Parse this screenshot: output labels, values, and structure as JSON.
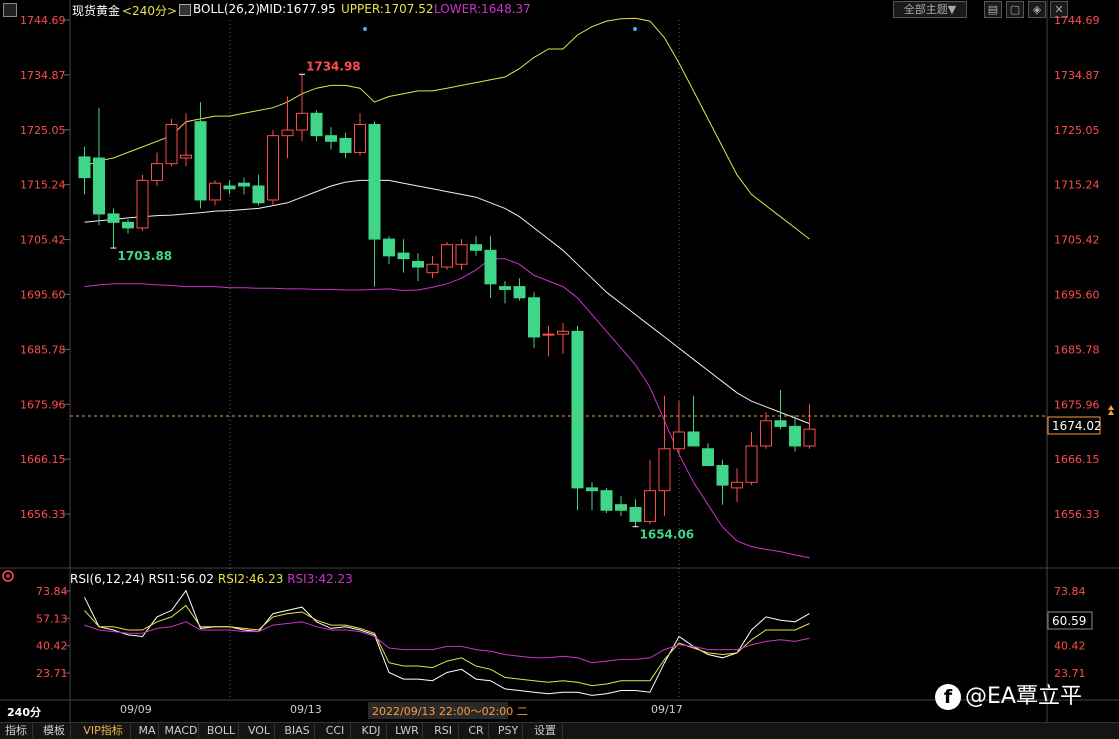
{
  "header": {
    "symbol": "现货黄金",
    "period": "<240分>",
    "indicator": "BOLL(26,2)",
    "mid": "MID:1677.95",
    "upper": "UPPER:1707.52",
    "lower": "LOWER:1648.37",
    "theme_button": "全部主题▼",
    "win_buttons": [
      "▤",
      "▢",
      "◈",
      "✕"
    ]
  },
  "main_chart": {
    "ticks": [
      "1744.69",
      "1734.87",
      "1725.05",
      "1715.24",
      "1705.42",
      "1695.60",
      "1685.78",
      "1675.96",
      "1666.15",
      "1656.33"
    ],
    "current_price": "1674.02",
    "high_label": "1734.98",
    "low_label_1": "1703.88",
    "low_label_2": "1654.06"
  },
  "rsi": {
    "title": "RSI(6,12,24)",
    "rsi1": "RSI1:56.02",
    "rsi2": "RSI2:46.23",
    "rsi3": "RSI3:42.23",
    "ticks": [
      "73.84",
      "57.13",
      "40.42",
      "23.71"
    ],
    "current": "60.59"
  },
  "time_axis": {
    "labels": [
      "09/09",
      "09/13",
      "09/17"
    ],
    "cursor_label": "2022/09/13 22:00～02:00 二"
  },
  "bottom_bar": {
    "period": "240分",
    "tabs": [
      "指标",
      "模板",
      "VIP指标",
      "MA",
      "MACD",
      "BOLL",
      "VOL",
      "BIAS",
      "CCI",
      "KDJ",
      "LWR",
      "RSI",
      "CR",
      "PSY",
      "设置"
    ]
  },
  "watermark": "@EA覃立平",
  "colors": {
    "up": "#ff4d4d",
    "down": "#3fd68a",
    "upper_band": "#e8e34a",
    "mid_band": "#f0f0f0",
    "lower_band": "#cc33cc",
    "axis_text": "#ff4d4d"
  },
  "chart_data": [
    {
      "type": "candlestick",
      "title": "现货黄金 240分",
      "ylim": [
        1652,
        1747
      ],
      "x": [
        "09/09",
        "09/13",
        "09/17"
      ],
      "candles": [
        {
          "o": 1720.2,
          "h": 1722.0,
          "l": 1713.5,
          "c": 1716.5
        },
        {
          "o": 1720.0,
          "h": 1729.0,
          "l": 1708.0,
          "c": 1710.0
        },
        {
          "o": 1710.0,
          "h": 1711.0,
          "l": 1703.9,
          "c": 1708.5
        },
        {
          "o": 1708.5,
          "h": 1709.0,
          "l": 1706.5,
          "c": 1707.5
        },
        {
          "o": 1707.5,
          "h": 1717.0,
          "l": 1707.0,
          "c": 1716.0
        },
        {
          "o": 1716.0,
          "h": 1721.0,
          "l": 1715.0,
          "c": 1719.0
        },
        {
          "o": 1719.0,
          "h": 1727.0,
          "l": 1718.5,
          "c": 1726.0
        },
        {
          "o": 1720.0,
          "h": 1728.0,
          "l": 1718.5,
          "c": 1720.5
        },
        {
          "o": 1726.5,
          "h": 1730.0,
          "l": 1711.0,
          "c": 1712.5
        },
        {
          "o": 1712.5,
          "h": 1716.0,
          "l": 1711.5,
          "c": 1715.5
        },
        {
          "o": 1715.0,
          "h": 1716.0,
          "l": 1713.5,
          "c": 1714.5
        },
        {
          "o": 1715.5,
          "h": 1716.5,
          "l": 1713.5,
          "c": 1715.0
        },
        {
          "o": 1715.0,
          "h": 1717.0,
          "l": 1711.5,
          "c": 1712.0
        },
        {
          "o": 1712.5,
          "h": 1725.0,
          "l": 1711.5,
          "c": 1724.0
        },
        {
          "o": 1724.0,
          "h": 1731.0,
          "l": 1720.0,
          "c": 1725.0
        },
        {
          "o": 1725.0,
          "h": 1734.98,
          "l": 1723.0,
          "c": 1728.0
        },
        {
          "o": 1728.0,
          "h": 1728.5,
          "l": 1723.0,
          "c": 1724.0
        },
        {
          "o": 1724.0,
          "h": 1725.5,
          "l": 1721.5,
          "c": 1723.0
        },
        {
          "o": 1723.5,
          "h": 1724.5,
          "l": 1720.0,
          "c": 1721.0
        },
        {
          "o": 1721.0,
          "h": 1728.0,
          "l": 1720.5,
          "c": 1726.0
        },
        {
          "o": 1726.0,
          "h": 1726.5,
          "l": 1697.0,
          "c": 1705.5
        },
        {
          "o": 1705.5,
          "h": 1706.0,
          "l": 1701.0,
          "c": 1702.5
        },
        {
          "o": 1703.0,
          "h": 1705.5,
          "l": 1699.5,
          "c": 1702.0
        },
        {
          "o": 1701.5,
          "h": 1703.0,
          "l": 1698.0,
          "c": 1700.5
        },
        {
          "o": 1699.5,
          "h": 1702.5,
          "l": 1698.5,
          "c": 1701.0
        },
        {
          "o": 1700.5,
          "h": 1705.0,
          "l": 1700.0,
          "c": 1704.5
        },
        {
          "o": 1701.0,
          "h": 1705.5,
          "l": 1700.0,
          "c": 1704.5
        },
        {
          "o": 1704.5,
          "h": 1706.0,
          "l": 1702.5,
          "c": 1703.5
        },
        {
          "o": 1703.5,
          "h": 1706.0,
          "l": 1695.0,
          "c": 1697.5
        },
        {
          "o": 1697.0,
          "h": 1698.0,
          "l": 1694.0,
          "c": 1696.5
        },
        {
          "o": 1697.0,
          "h": 1698.5,
          "l": 1694.5,
          "c": 1695.0
        },
        {
          "o": 1695.0,
          "h": 1696.0,
          "l": 1686.0,
          "c": 1688.0
        },
        {
          "o": 1688.5,
          "h": 1690.0,
          "l": 1684.5,
          "c": 1688.5
        },
        {
          "o": 1688.5,
          "h": 1690.5,
          "l": 1685.0,
          "c": 1689.0
        },
        {
          "o": 1689.0,
          "h": 1690.0,
          "l": 1657.0,
          "c": 1661.0
        },
        {
          "o": 1661.0,
          "h": 1662.0,
          "l": 1657.0,
          "c": 1660.5
        },
        {
          "o": 1660.5,
          "h": 1661.0,
          "l": 1656.5,
          "c": 1657.0
        },
        {
          "o": 1658.0,
          "h": 1659.5,
          "l": 1656.0,
          "c": 1657.0
        },
        {
          "o": 1657.5,
          "h": 1659.0,
          "l": 1654.06,
          "c": 1655.0
        },
        {
          "o": 1655.0,
          "h": 1666.0,
          "l": 1654.5,
          "c": 1660.5
        },
        {
          "o": 1660.5,
          "h": 1677.5,
          "l": 1656.0,
          "c": 1668.0
        },
        {
          "o": 1668.0,
          "h": 1676.5,
          "l": 1667.0,
          "c": 1671.0
        },
        {
          "o": 1671.0,
          "h": 1677.5,
          "l": 1669.5,
          "c": 1668.5
        },
        {
          "o": 1668.0,
          "h": 1669.0,
          "l": 1665.0,
          "c": 1665.0
        },
        {
          "o": 1665.0,
          "h": 1666.0,
          "l": 1658.0,
          "c": 1661.5
        },
        {
          "o": 1661.0,
          "h": 1664.5,
          "l": 1658.5,
          "c": 1662.0
        },
        {
          "o": 1662.0,
          "h": 1671.0,
          "l": 1661.5,
          "c": 1668.5
        },
        {
          "o": 1668.5,
          "h": 1674.5,
          "l": 1668.0,
          "c": 1673.0
        },
        {
          "o": 1673.0,
          "h": 1678.5,
          "l": 1671.5,
          "c": 1672.0
        },
        {
          "o": 1672.0,
          "h": 1674.0,
          "l": 1667.5,
          "c": 1668.5
        },
        {
          "o": 1668.5,
          "h": 1676.0,
          "l": 1668.0,
          "c": 1671.5
        }
      ],
      "upper": [
        1718.5,
        1719.5,
        1720.0,
        1721.0,
        1722.0,
        1723.0,
        1724.0,
        1726.5,
        1727.0,
        1727.5,
        1727.5,
        1728.0,
        1728.5,
        1729.0,
        1730.0,
        1731.5,
        1732.5,
        1733.0,
        1733.0,
        1732.5,
        1730.0,
        1731.0,
        1731.5,
        1732.0,
        1732.0,
        1732.5,
        1733.0,
        1733.5,
        1734.0,
        1734.5,
        1736.0,
        1738.0,
        1739.5,
        1739.5,
        1742.0,
        1743.5,
        1744.5,
        1744.9,
        1745.0,
        1744.5,
        1741.5,
        1737.0,
        1732.0,
        1727.0,
        1722.0,
        1717.0,
        1713.5,
        1711.5,
        1709.5,
        1707.5,
        1705.5
      ],
      "mid": [
        1708.5,
        1708.8,
        1709.0,
        1709.3,
        1709.5,
        1709.7,
        1709.8,
        1710.0,
        1710.2,
        1710.5,
        1710.6,
        1710.8,
        1711.0,
        1711.5,
        1712.0,
        1713.0,
        1714.0,
        1715.0,
        1715.7,
        1716.0,
        1716.0,
        1716.0,
        1715.5,
        1715.0,
        1714.5,
        1714.0,
        1713.5,
        1713.0,
        1712.0,
        1711.0,
        1709.5,
        1707.5,
        1705.5,
        1703.5,
        1701.0,
        1698.5,
        1696.0,
        1694.0,
        1692.0,
        1690.0,
        1688.0,
        1686.0,
        1684.0,
        1682.0,
        1680.0,
        1678.0,
        1676.5,
        1675.5,
        1674.5,
        1673.5,
        1672.5
      ],
      "lower": [
        1697.0,
        1697.3,
        1697.5,
        1697.5,
        1697.5,
        1697.3,
        1697.2,
        1697.0,
        1697.0,
        1697.0,
        1696.8,
        1696.8,
        1696.7,
        1696.7,
        1696.6,
        1696.6,
        1696.5,
        1696.5,
        1696.4,
        1696.4,
        1696.5,
        1696.6,
        1696.3,
        1696.4,
        1696.9,
        1697.5,
        1698.5,
        1700.0,
        1702.0,
        1702.0,
        1701.0,
        1699.0,
        1698.0,
        1697.0,
        1695.0,
        1692.0,
        1689.0,
        1686.0,
        1683.0,
        1679.0,
        1673.0,
        1667.0,
        1662.0,
        1658.0,
        1654.0,
        1651.5,
        1650.5,
        1650.0,
        1649.6,
        1649.0,
        1648.5
      ]
    },
    {
      "type": "line",
      "title": "RSI(6,12,24)",
      "ylim": [
        15,
        82
      ],
      "series": [
        {
          "name": "RSI1",
          "values": [
            70,
            52,
            50,
            47,
            46,
            58,
            62,
            74,
            51,
            52,
            52,
            50,
            49,
            60,
            62,
            64,
            55,
            51,
            52,
            50,
            47,
            24,
            20,
            20,
            19,
            24,
            26,
            20,
            19,
            14,
            13,
            12,
            11,
            12,
            12,
            10,
            11,
            13,
            13,
            12,
            30,
            46,
            40,
            35,
            33,
            36,
            50,
            58,
            56,
            55,
            60
          ]
        },
        {
          "name": "RSI2",
          "values": [
            62,
            52,
            52,
            50,
            50,
            55,
            58,
            65,
            52,
            52,
            52,
            51,
            50,
            58,
            60,
            61,
            56,
            53,
            53,
            51,
            48,
            30,
            28,
            28,
            27,
            31,
            33,
            28,
            26,
            21,
            20,
            19,
            18,
            19,
            18,
            16,
            17,
            19,
            19,
            19,
            32,
            42,
            39,
            36,
            35,
            36,
            44,
            50,
            50,
            50,
            54
          ]
        },
        {
          "name": "RSI3",
          "values": [
            53,
            50,
            49,
            48,
            48,
            51,
            52,
            55,
            50,
            50,
            50,
            49,
            49,
            53,
            54,
            55,
            52,
            50,
            50,
            49,
            46,
            39,
            38,
            38,
            38,
            40,
            40,
            38,
            37,
            35,
            34,
            33,
            33,
            34,
            33,
            30,
            31,
            32,
            32,
            33,
            38,
            41,
            40,
            38,
            38,
            38,
            41,
            43,
            44,
            43,
            45
          ]
        }
      ]
    }
  ]
}
